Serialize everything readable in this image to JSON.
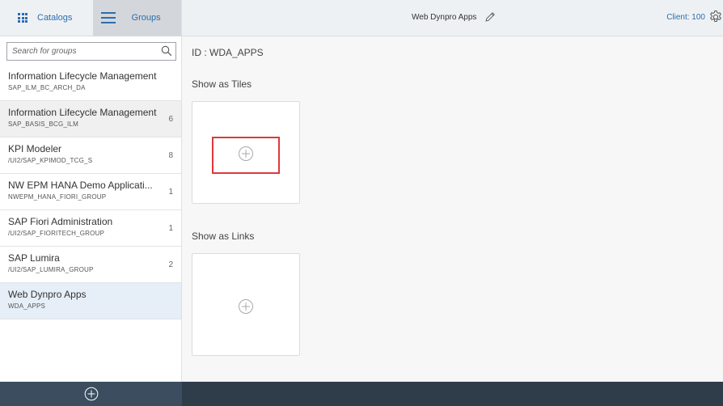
{
  "header": {
    "tabs": {
      "catalogs": "Catalogs",
      "groups": "Groups"
    },
    "title": "Web Dynpro Apps",
    "client": "Client: 100"
  },
  "sidebar": {
    "search": {
      "placeholder": "Search for groups",
      "value": ""
    },
    "groups": [
      {
        "title": "Information Lifecycle Management",
        "id": "SAP_ILM_BC_ARCH_DA",
        "count": ""
      },
      {
        "title": "Information Lifecycle Management",
        "id": "SAP_BASIS_BCG_ILM",
        "count": "6"
      },
      {
        "title": "KPI Modeler",
        "id": "/UI2/SAP_KPIMOD_TCG_S",
        "count": "8"
      },
      {
        "title": "NW EPM HANA Demo Applicati...",
        "id": "NWEPM_HANA_FIORI_GROUP",
        "count": "1"
      },
      {
        "title": "SAP Fiori Administration",
        "id": "/UI2/SAP_FIORITECH_GROUP",
        "count": "1"
      },
      {
        "title": "SAP Lumira",
        "id": "/UI2/SAP_LUMIRA_GROUP",
        "count": "2"
      },
      {
        "title": "Web Dynpro Apps",
        "id": "WDA_APPS",
        "count": ""
      }
    ]
  },
  "main": {
    "id_label": "ID : WDA_APPS",
    "tiles_label": "Show as Tiles",
    "links_label": "Show as Links"
  },
  "colors": {
    "accent": "#2a6eae",
    "highlight": "#e0373c",
    "footer": "#3b4d5f"
  }
}
